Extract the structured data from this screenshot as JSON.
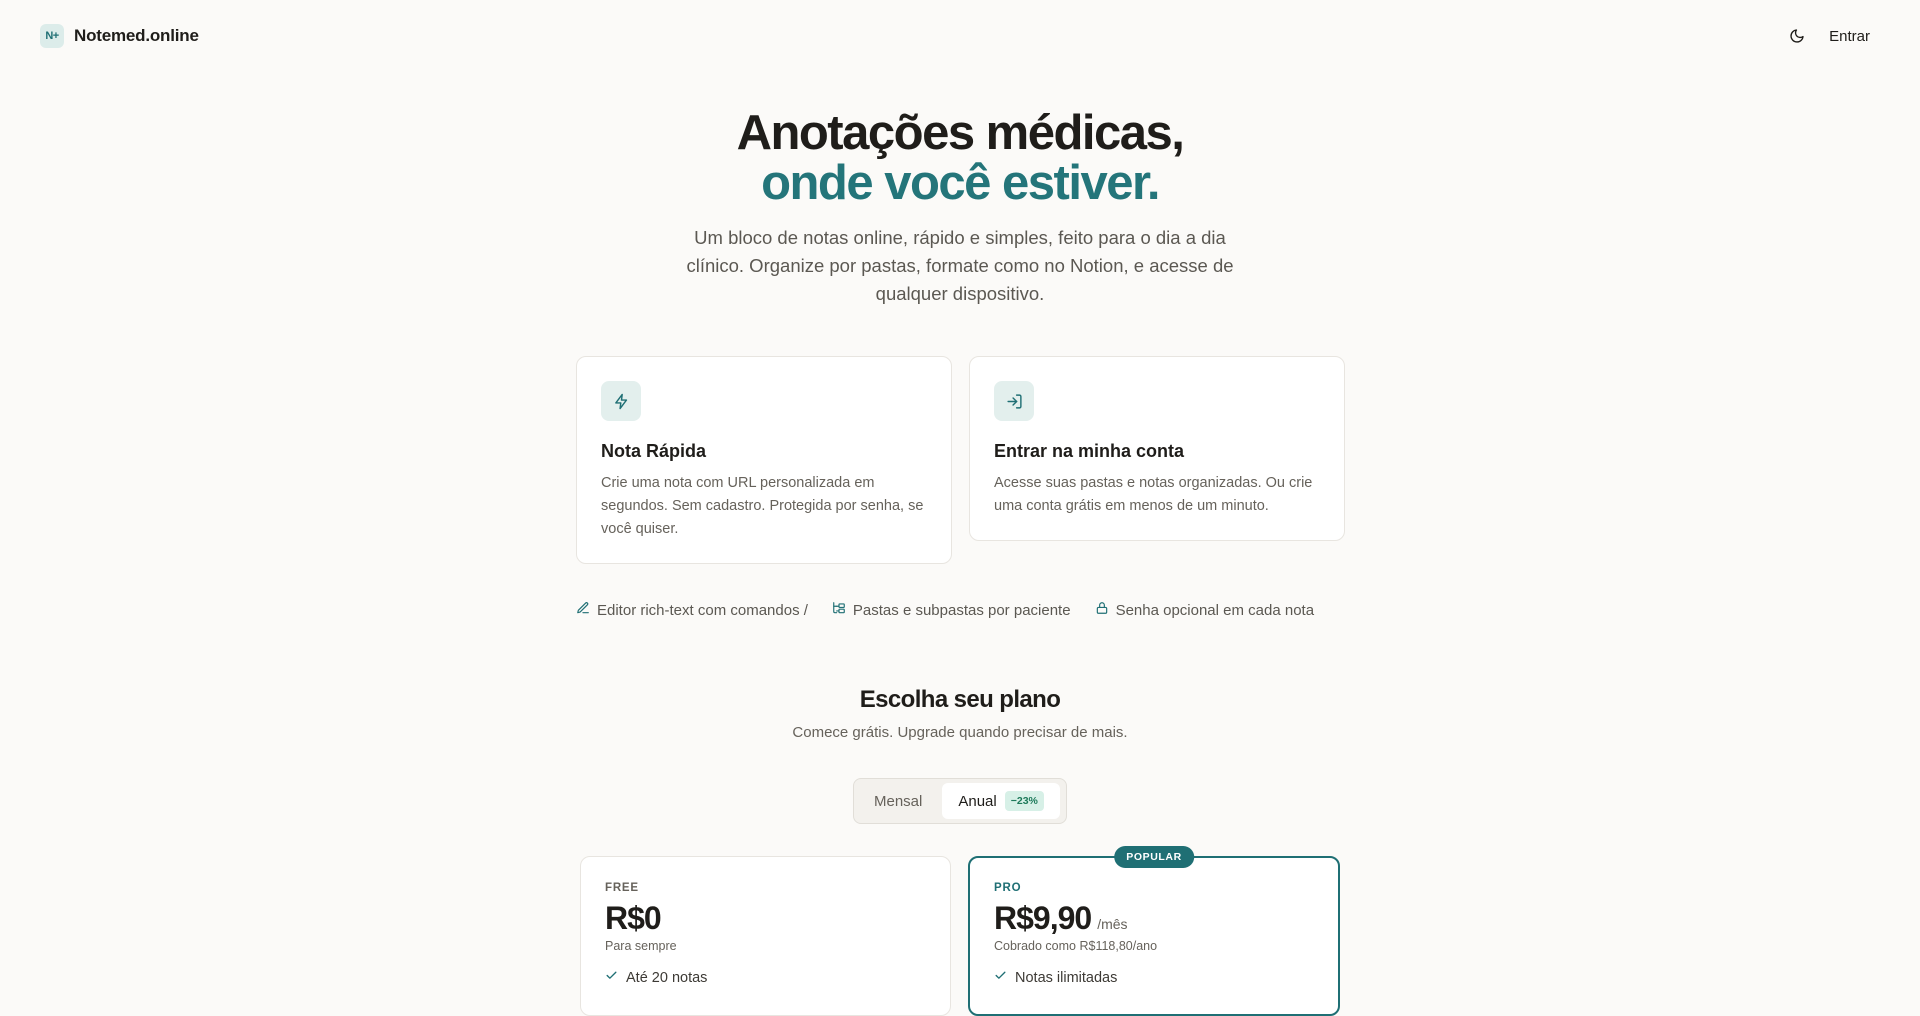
{
  "header": {
    "logo_mark": "N+",
    "brand_name": "Notemed.online",
    "theme_icon": "moon-icon",
    "login_label": "Entrar"
  },
  "hero": {
    "title_line1": "Anotações médicas,",
    "title_line2": "onde você estiver.",
    "subtitle": "Um bloco de notas online, rápido e simples, feito para o dia a dia clínico. Organize por pastas, formate como no Notion, e acesse de qualquer dispositivo."
  },
  "cards": [
    {
      "icon": "lightning-icon",
      "title": "Nota Rápida",
      "description": "Crie uma nota com URL personalizada em segundos. Sem cadastro. Protegida por senha, se você quiser."
    },
    {
      "icon": "login-icon",
      "title": "Entrar na minha conta",
      "description": "Acesse suas pastas e notas organizadas. Ou crie uma conta grátis em menos de um minuto."
    }
  ],
  "features": [
    {
      "icon": "pencil-icon",
      "label": "Editor rich-text com comandos /"
    },
    {
      "icon": "folder-tree-icon",
      "label": "Pastas e subpastas por paciente"
    },
    {
      "icon": "lock-icon",
      "label": "Senha opcional em cada nota"
    }
  ],
  "pricing": {
    "title": "Escolha seu plano",
    "subtitle": "Comece grátis. Upgrade quando precisar de mais.",
    "toggle": {
      "monthly_label": "Mensal",
      "annual_label": "Anual",
      "discount_badge": "−23%",
      "selected": "Anual"
    },
    "plans": [
      {
        "badge": "",
        "name": "FREE",
        "price": "R$0",
        "period": "",
        "note": "Para sempre",
        "features": [
          "Até 20 notas"
        ]
      },
      {
        "badge": "POPULAR",
        "name": "PRO",
        "price": "R$9,90",
        "period": "/mês",
        "note": "Cobrado como R$118,80/ano",
        "features": [
          "Notas ilimitadas"
        ]
      }
    ]
  },
  "colors": {
    "accent": "#1f6f74",
    "accent_soft": "#e3efed",
    "background": "#fbfaf8",
    "text": "#1f1d1a"
  }
}
